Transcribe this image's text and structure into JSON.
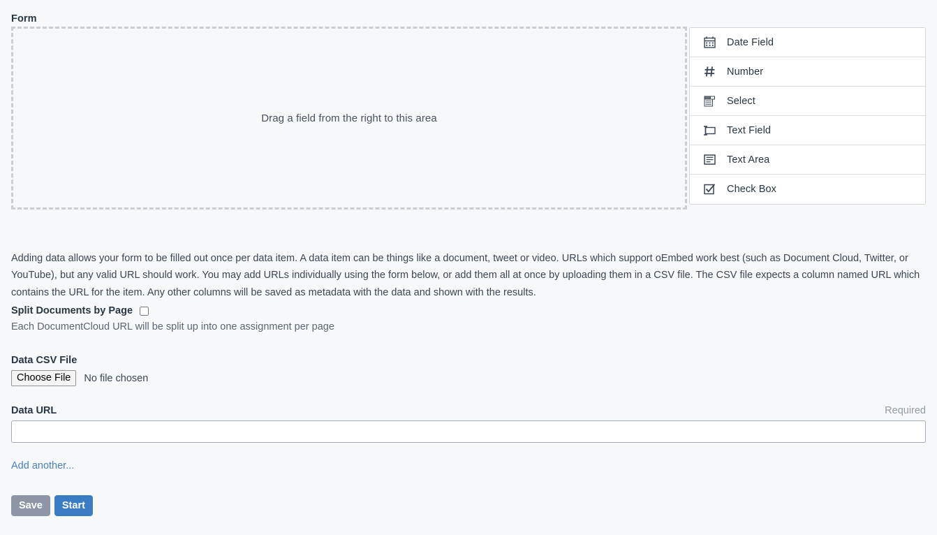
{
  "form_builder": {
    "section_label": "Form",
    "dropzone_text": "Drag a field from the right to this area",
    "palette": [
      {
        "label": "Date Field",
        "icon": "calendar-icon"
      },
      {
        "label": "Number",
        "icon": "hash-icon"
      },
      {
        "label": "Select",
        "icon": "dropdown-list-icon"
      },
      {
        "label": "Text Field",
        "icon": "text-input-icon"
      },
      {
        "label": "Text Area",
        "icon": "text-area-icon"
      },
      {
        "label": "Check Box",
        "icon": "checked-box-icon"
      }
    ]
  },
  "description": "Adding data allows your form to be filled out once per data item. A data item can be things like a document, tweet or video. URLs which support oEmbed work best (such as Document Cloud, Twitter, or YouTube), but any valid URL should work. You may add URLs individually using the form below, or add them all at once by uploading them in a CSV file. The CSV file expects a column named URL which contains the URL for the item. Any other columns will be saved as metadata with the data and shown with the results.",
  "split_documents": {
    "label": "Split Documents by Page",
    "checked": false,
    "help_text": "Each DocumentCloud URL will be split up into one assignment per page"
  },
  "csv_file": {
    "label": "Data CSV File",
    "button_label": "Choose File",
    "status_text": "No file chosen"
  },
  "data_url": {
    "label": "Data URL",
    "required_text": "Required",
    "value": "",
    "placeholder": ""
  },
  "add_another_label": "Add another...",
  "actions": {
    "save_label": "Save",
    "start_label": "Start"
  },
  "colors": {
    "page_background": "#f7f8fa",
    "save_button": "#8d96a4",
    "start_button": "#3b7dc4",
    "link": "#4a7fc1",
    "dashed_border": "#cacdd1"
  }
}
